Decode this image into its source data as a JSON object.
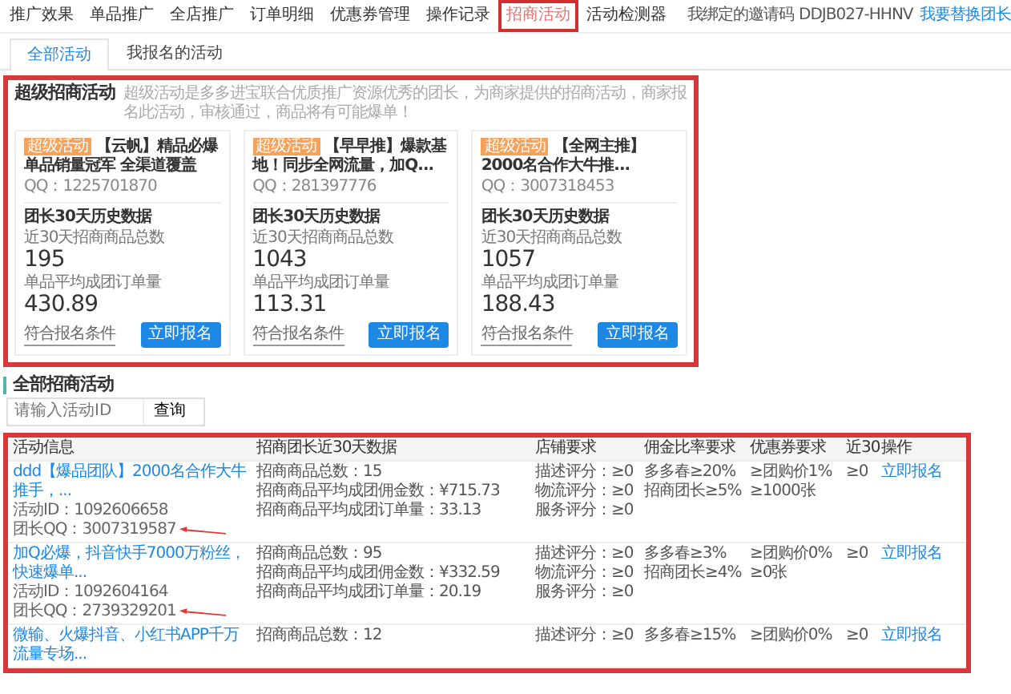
{
  "nav": {
    "items": [
      {
        "label": "推广效果",
        "selected": false
      },
      {
        "label": "单品推广",
        "selected": false
      },
      {
        "label": "全店推广",
        "selected": false
      },
      {
        "label": "订单明细",
        "selected": false
      },
      {
        "label": "优惠券管理",
        "selected": false
      },
      {
        "label": "操作记录",
        "selected": false
      },
      {
        "label": "招商活动",
        "selected": true
      },
      {
        "label": "活动检测器",
        "selected": false
      }
    ],
    "invite_label": "我绑定的邀请码",
    "invite_code": "DDJB027-HHNV",
    "replace_link": "我要替换团长"
  },
  "tabs": [
    {
      "label": "全部活动",
      "selected": true
    },
    {
      "label": "我报名的活动",
      "selected": false
    }
  ],
  "super_section": {
    "title": "超级招商活动",
    "description": "超级活动是多多进宝联合优质推广资源优秀的团长，为商家提供的招商活动，商家报名此活动，审核通过，商品将有可能爆单！",
    "highlighted": true,
    "cards": [
      {
        "badge": "超级活动",
        "title": "【云帆】精品必爆单品销量冠军 全渠道覆盖",
        "qq": "QQ：1225701870",
        "history_label": "团长30天历史数据",
        "count_label": "近30天招商商品总数",
        "count": "195",
        "avg_label": "单品平均成团订单量",
        "avg": "430.89",
        "conditions": "符合报名条件",
        "apply": "立即报名"
      },
      {
        "badge": "超级活动",
        "title": "【早早推】爆款基地！同步全网流量，加Q...",
        "qq": "QQ：281397776",
        "history_label": "团长30天历史数据",
        "count_label": "近30天招商商品总数",
        "count": "1043",
        "avg_label": "单品平均成团订单量",
        "avg": "113.31",
        "conditions": "符合报名条件",
        "apply": "立即报名"
      },
      {
        "badge": "超级活动",
        "title": "【全网主推】2000名合作大牛推...",
        "qq": "QQ：3007318453",
        "history_label": "团长30天历史数据",
        "count_label": "近30天招商商品总数",
        "count": "1057",
        "avg_label": "单品平均成团订单量",
        "avg": "188.43",
        "conditions": "符合报名条件",
        "apply": "立即报名"
      }
    ]
  },
  "all_section": {
    "title": "全部招商活动",
    "search": {
      "placeholder": "请输入活动ID",
      "button": "查询"
    }
  },
  "table": {
    "highlighted": true,
    "columns": [
      "活动信息",
      "招商团长近30天数据",
      "店铺要求",
      "佣金比率要求",
      "优惠券要求",
      "近30",
      "操作"
    ],
    "rows": [
      {
        "title": "ddd【爆品团队】2000名合作大牛推手，...",
        "activity_id": "活动ID：1092606658",
        "leader_qq": "团长QQ：3007319587",
        "arrow": true,
        "data": [
          "招商商品总数：15",
          "招商商品平均成团佣金数：¥715.73",
          "招商商品平均成团订单量：33.13"
        ],
        "store": [
          "描述评分：≥0",
          "物流评分：≥0",
          "服务评分：≥0"
        ],
        "commission": [
          "多多春≥20%",
          "招商团长≥5%"
        ],
        "coupon": [
          "≥团购价1%",
          "≥1000张"
        ],
        "recent": "≥0",
        "action": "立即报名"
      },
      {
        "title": "加Q必爆，抖音快手7000万粉丝，快速爆单...",
        "activity_id": "活动ID：1092604164",
        "leader_qq": "团长QQ：2739329201",
        "arrow": true,
        "data": [
          "招商商品总数：95",
          "招商商品平均成团佣金数：¥332.59",
          "招商商品平均成团订单量：20.19"
        ],
        "store": [
          "描述评分：≥0",
          "物流评分：≥0",
          "服务评分：≥0"
        ],
        "commission": [
          "多多春≥3%",
          "招商团长≥4%"
        ],
        "coupon": [
          "≥团购价0%",
          "≥0张"
        ],
        "recent": "≥0",
        "action": "立即报名"
      },
      {
        "title": "微输、火爆抖音、小红书APP千万流量专场...",
        "arrow": false,
        "data": [
          "招商商品总数：12"
        ],
        "store": [
          "描述评分：≥0"
        ],
        "commission": [
          "多多春≥15%"
        ],
        "coupon": [
          "≥团购价0%"
        ],
        "recent": "≥0",
        "action": "立即报名"
      }
    ]
  }
}
